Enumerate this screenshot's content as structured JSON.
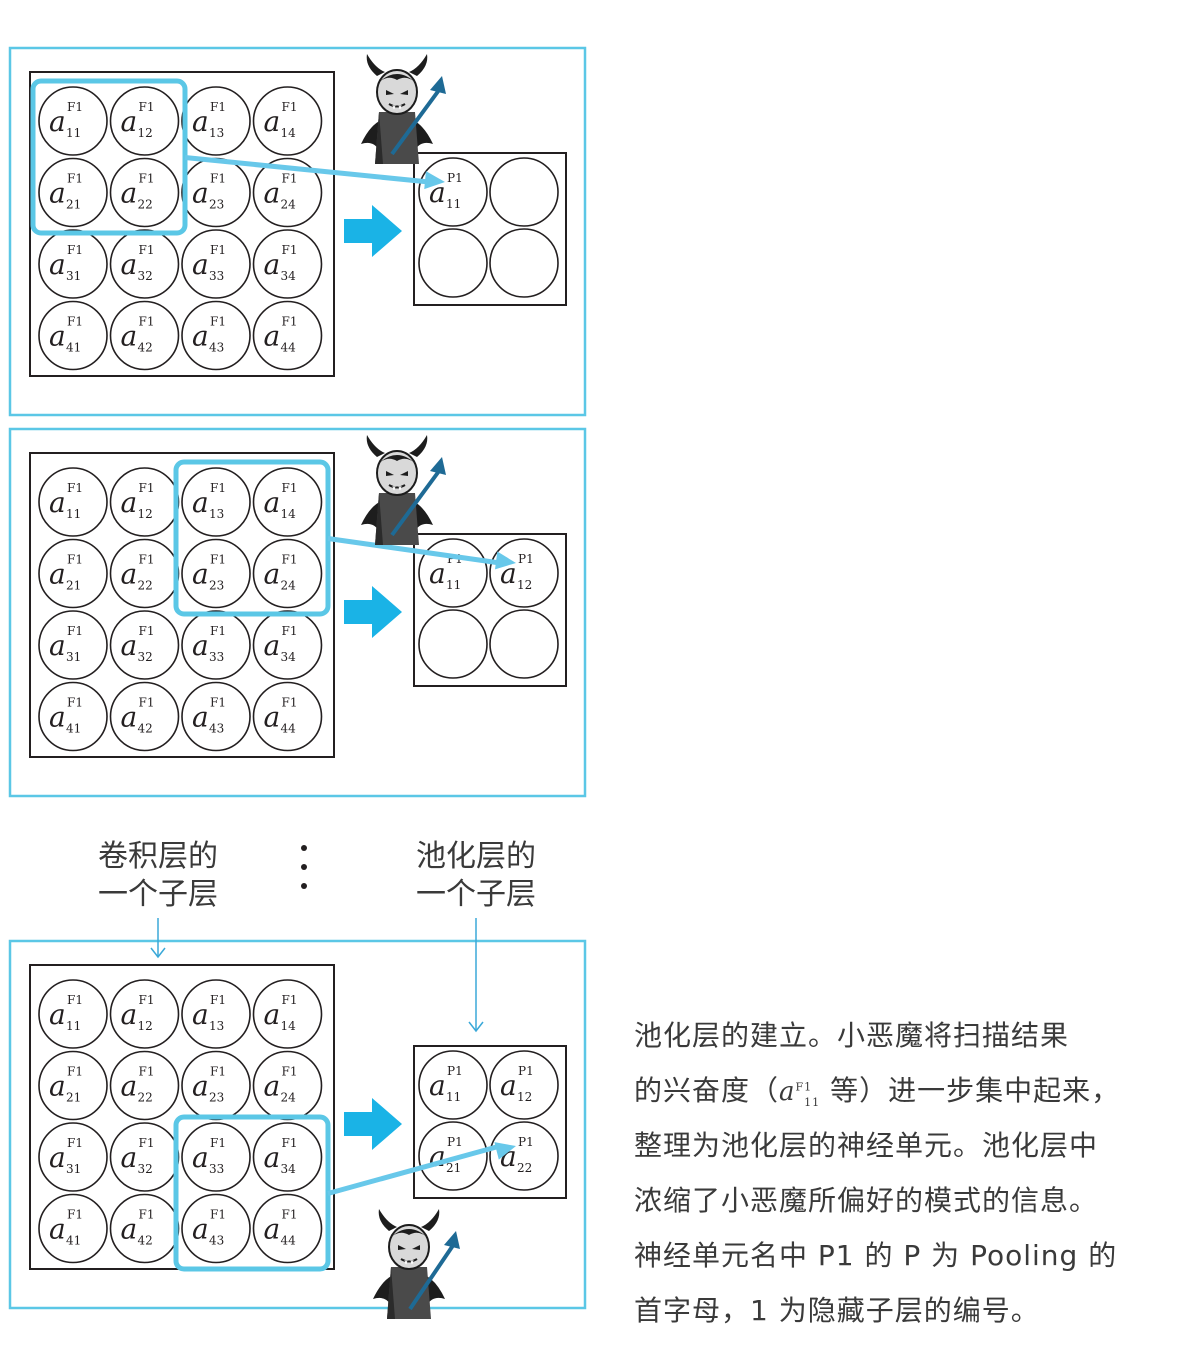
{
  "symbol": {
    "base": "a"
  },
  "labels": {
    "conv_sublayer": [
      "卷积层的",
      "一个子层"
    ],
    "pool_sublayer": [
      "池化层的",
      "一个子层"
    ]
  },
  "panels": [
    {
      "grid": [
        [
          {
            "sup": "F1",
            "sub": "11"
          },
          {
            "sup": "F1",
            "sub": "12"
          },
          {
            "sup": "F1",
            "sub": "13"
          },
          {
            "sup": "F1",
            "sub": "14"
          }
        ],
        [
          {
            "sup": "F1",
            "sub": "21"
          },
          {
            "sup": "F1",
            "sub": "22"
          },
          {
            "sup": "F1",
            "sub": "23"
          },
          {
            "sup": "F1",
            "sub": "24"
          }
        ],
        [
          {
            "sup": "F1",
            "sub": "31"
          },
          {
            "sup": "F1",
            "sub": "32"
          },
          {
            "sup": "F1",
            "sub": "33"
          },
          {
            "sup": "F1",
            "sub": "34"
          }
        ],
        [
          {
            "sup": "F1",
            "sub": "41"
          },
          {
            "sup": "F1",
            "sub": "42"
          },
          {
            "sup": "F1",
            "sub": "43"
          },
          {
            "sup": "F1",
            "sub": "44"
          }
        ]
      ],
      "highlight": {
        "row": 0,
        "col": 0
      },
      "pool": [
        [
          {
            "sup": "P1",
            "sub": "11"
          },
          null
        ],
        [
          null,
          null
        ]
      ],
      "target": {
        "row": 0,
        "col": 0
      }
    },
    {
      "grid": [
        [
          {
            "sup": "F1",
            "sub": "11"
          },
          {
            "sup": "F1",
            "sub": "12"
          },
          {
            "sup": "F1",
            "sub": "13"
          },
          {
            "sup": "F1",
            "sub": "14"
          }
        ],
        [
          {
            "sup": "F1",
            "sub": "21"
          },
          {
            "sup": "F1",
            "sub": "22"
          },
          {
            "sup": "F1",
            "sub": "23"
          },
          {
            "sup": "F1",
            "sub": "24"
          }
        ],
        [
          {
            "sup": "F1",
            "sub": "31"
          },
          {
            "sup": "F1",
            "sub": "32"
          },
          {
            "sup": "F1",
            "sub": "33"
          },
          {
            "sup": "F1",
            "sub": "34"
          }
        ],
        [
          {
            "sup": "F1",
            "sub": "41"
          },
          {
            "sup": "F1",
            "sub": "42"
          },
          {
            "sup": "F1",
            "sub": "43"
          },
          {
            "sup": "F1",
            "sub": "44"
          }
        ]
      ],
      "highlight": {
        "row": 0,
        "col": 2
      },
      "pool": [
        [
          {
            "sup": "P1",
            "sub": "11"
          },
          {
            "sup": "P1",
            "sub": "12"
          }
        ],
        [
          null,
          null
        ]
      ],
      "target": {
        "row": 0,
        "col": 1
      }
    },
    {
      "grid": [
        [
          {
            "sup": "F1",
            "sub": "11"
          },
          {
            "sup": "F1",
            "sub": "12"
          },
          {
            "sup": "F1",
            "sub": "13"
          },
          {
            "sup": "F1",
            "sub": "14"
          }
        ],
        [
          {
            "sup": "F1",
            "sub": "21"
          },
          {
            "sup": "F1",
            "sub": "22"
          },
          {
            "sup": "F1",
            "sub": "23"
          },
          {
            "sup": "F1",
            "sub": "24"
          }
        ],
        [
          {
            "sup": "F1",
            "sub": "31"
          },
          {
            "sup": "F1",
            "sub": "32"
          },
          {
            "sup": "F1",
            "sub": "33"
          },
          {
            "sup": "F1",
            "sub": "34"
          }
        ],
        [
          {
            "sup": "F1",
            "sub": "41"
          },
          {
            "sup": "F1",
            "sub": "42"
          },
          {
            "sup": "F1",
            "sub": "43"
          },
          {
            "sup": "F1",
            "sub": "44"
          }
        ]
      ],
      "highlight": {
        "row": 2,
        "col": 2
      },
      "pool": [
        [
          {
            "sup": "P1",
            "sub": "11"
          },
          {
            "sup": "P1",
            "sub": "12"
          }
        ],
        [
          {
            "sup": "P1",
            "sub": "21"
          },
          {
            "sup": "P1",
            "sub": "22"
          }
        ]
      ],
      "target": {
        "row": 1,
        "col": 1
      }
    }
  ],
  "caption": {
    "line1": "池化层的建立。小恶魔将扫描结果",
    "line2_before": "的兴奋度（",
    "line2_sym_sup": "F1",
    "line2_sym_sub": "11",
    "line2_after": "等）进一步集中起来，",
    "line3": "整理为池化层的神经单元。池化层中",
    "line4": "浓缩了小恶魔所偏好的模式的信息。",
    "line5": "神经单元名中 P1 的 P 为 Pooling 的",
    "line6": "首字母，1 为隐藏子层的编号。"
  },
  "colors": {
    "frame": "#5bc7e6",
    "highlight": "#5bc7e6",
    "big_arrow": "#1ab3e6",
    "devil_arrow": "#1e6a95"
  },
  "icons": [
    "devil-icon",
    "right-arrow-icon",
    "down-arrow-icon"
  ]
}
